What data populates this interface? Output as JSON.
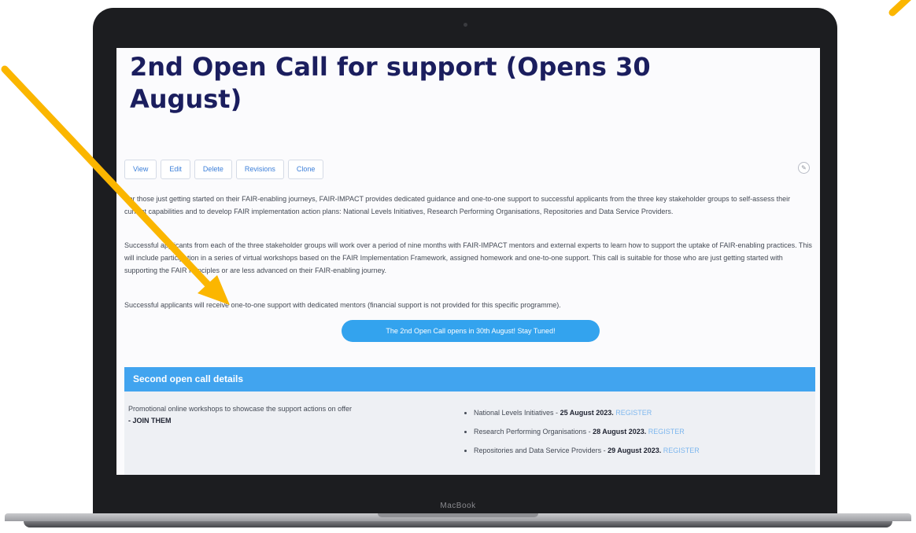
{
  "page": {
    "title": "2nd Open Call for support (Opens 30 August)"
  },
  "tabs": [
    "View",
    "Edit",
    "Delete",
    "Revisions",
    "Clone"
  ],
  "body": {
    "paragraphs": [
      "For those just getting started on their FAIR-enabling journeys, FAIR-IMPACT provides dedicated guidance and one-to-one support to successful applicants from the three key stakeholder groups to self-assess their current capabilities and to develop FAIR implementation action plans: National Levels Initiatives, Research Performing Organisations, Repositories and Data Service Providers.",
      "Successful applicants from each of the three stakeholder groups will work over a period of nine months with FAIR-IMPACT mentors and external experts to learn how to support the uptake of FAIR-enabling practices. This will include participation in a series of virtual workshops based on the FAIR Implementation Framework, assigned homework and one-to-one support. This call is suitable for those who are just getting started with supporting the FAIR Principles or are less advanced on their FAIR-enabling journey.",
      "Successful applicants will receive one-to-one support with dedicated mentors (financial support is not provided for this specific programme)."
    ],
    "cta_label": "The 2nd Open Call opens in 30th August! Stay Tuned!"
  },
  "details": {
    "heading": "Second open call details",
    "promo_text": "Promotional online workshops to showcase the support actions on offer",
    "join_label": "- JOIN THEM",
    "workshops": [
      {
        "name": "National Levels Initiatives - ",
        "date": "25 August 2023.",
        "register": "REGISTER"
      },
      {
        "name": "Research Performing Organisations - ",
        "date": "28 August 2023.",
        "register": "REGISTER"
      },
      {
        "name": "Repositories and Data Service Providers - ",
        "date": "29 August 2023.",
        "register": "REGISTER"
      }
    ]
  },
  "device": {
    "label": "MacBook"
  },
  "annotation": {
    "arrow_color": "#fbb600"
  }
}
